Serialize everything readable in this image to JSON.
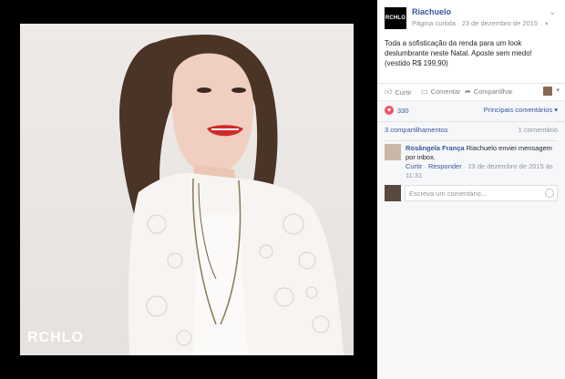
{
  "photo": {
    "logo_text": "RCHLO"
  },
  "post": {
    "page_avatar_text": "RCHLO",
    "page_name": "Riachuelo",
    "page_meta": "Página curtida · 23 de dezembro de 2015 · ",
    "text": "Toda a sofisticação da renda para um look deslumbrante neste Natal. Aposte sem medo! (vestido R$ 199,90)"
  },
  "actions": {
    "like": "Curtir",
    "comment": "Comentar",
    "share": "Compartilhar"
  },
  "feedback": {
    "reaction_count": "330",
    "sort_label": "Principais comentários",
    "shares": "3 compartilhamentos",
    "comments_count": "1 comentário"
  },
  "comment": {
    "author": "Rosângela França",
    "text": "Riachuelo enviei mensagem por inbox.",
    "like": "Curtir",
    "reply": "Responder",
    "date": "23 de dezembro de 2015 às 11:31"
  },
  "reply": {
    "placeholder": "Escreva um comentário..."
  },
  "colors": {
    "link": "#365899",
    "meta": "#90949c",
    "heart": "#f25268"
  }
}
